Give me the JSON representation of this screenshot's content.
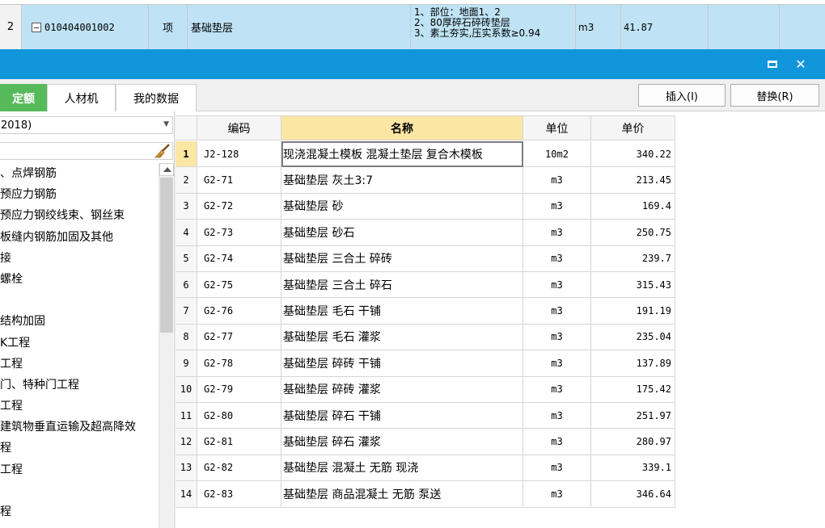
{
  "background_row": {
    "index": "2",
    "code": "010404001002",
    "unit": "项",
    "name": "基础垫层",
    "description_lines": [
      "1、部位：地面1、2",
      "2、80厚碎石碎砖垫层",
      "3、素土夯实,压实系数≥0.94"
    ],
    "measure_unit": "m3",
    "quantity": "41.87"
  },
  "colors": {
    "titlebar": "#1195db",
    "active_tab": "#56ba5a",
    "selected_row": "#bfe3f5",
    "sorted_header": "#fce6a4"
  },
  "dialog": {
    "maximize_icon": "maximize-icon",
    "close_icon": "close-icon",
    "close_glyph": "✕"
  },
  "tabs": [
    {
      "label": "定额",
      "active": true
    },
    {
      "label": "人材机",
      "active": false
    },
    {
      "label": "我的数据",
      "active": false
    }
  ],
  "toolbar": {
    "insert_label": "插入(I)",
    "replace_label": "替换(R)"
  },
  "left_panel": {
    "library_value": "2018)",
    "search_value": "",
    "clear_icon": "broom-icon",
    "tree_items": [
      "、点焊钢筋",
      "预应力钢筋",
      "预应力钢绞线束、钢丝束",
      "板缝内钢筋加固及其他",
      "接",
      "螺栓",
      "",
      "结构加固",
      "K工程",
      "工程",
      "门、特种门工程",
      "工程",
      "建筑物垂直运输及超高降效",
      "程",
      "工程",
      "",
      "程"
    ]
  },
  "grid": {
    "headers": {
      "code": "编码",
      "name": "名称",
      "unit": "单位",
      "price": "单价"
    },
    "rows": [
      {
        "idx": "1",
        "code": "J2-128",
        "name": "现浇混凝土模板 混凝土垫层 复合木模板",
        "unit": "10m2",
        "price": "340.22"
      },
      {
        "idx": "2",
        "code": "G2-71",
        "name": "基础垫层 灰土3:7",
        "unit": "m3",
        "price": "213.45"
      },
      {
        "idx": "3",
        "code": "G2-72",
        "name": "基础垫层 砂",
        "unit": "m3",
        "price": "169.4"
      },
      {
        "idx": "4",
        "code": "G2-73",
        "name": "基础垫层 砂石",
        "unit": "m3",
        "price": "250.75"
      },
      {
        "idx": "5",
        "code": "G2-74",
        "name": "基础垫层 三合土 碎砖",
        "unit": "m3",
        "price": "239.7"
      },
      {
        "idx": "6",
        "code": "G2-75",
        "name": "基础垫层 三合土 碎石",
        "unit": "m3",
        "price": "315.43"
      },
      {
        "idx": "7",
        "code": "G2-76",
        "name": "基础垫层 毛石 干铺",
        "unit": "m3",
        "price": "191.19"
      },
      {
        "idx": "8",
        "code": "G2-77",
        "name": "基础垫层 毛石 灌浆",
        "unit": "m3",
        "price": "235.04"
      },
      {
        "idx": "9",
        "code": "G2-78",
        "name": "基础垫层 碎砖 干铺",
        "unit": "m3",
        "price": "137.89"
      },
      {
        "idx": "10",
        "code": "G2-79",
        "name": "基础垫层 碎砖 灌浆",
        "unit": "m3",
        "price": "175.42"
      },
      {
        "idx": "11",
        "code": "G2-80",
        "name": "基础垫层 碎石 干铺",
        "unit": "m3",
        "price": "251.97"
      },
      {
        "idx": "12",
        "code": "G2-81",
        "name": "基础垫层 碎石 灌浆",
        "unit": "m3",
        "price": "280.97"
      },
      {
        "idx": "13",
        "code": "G2-82",
        "name": "基础垫层 混凝土 无筋 现浇",
        "unit": "m3",
        "price": "339.1"
      },
      {
        "idx": "14",
        "code": "G2-83",
        "name": "基础垫层 商品混凝土 无筋 泵送",
        "unit": "m3",
        "price": "346.64"
      }
    ]
  }
}
